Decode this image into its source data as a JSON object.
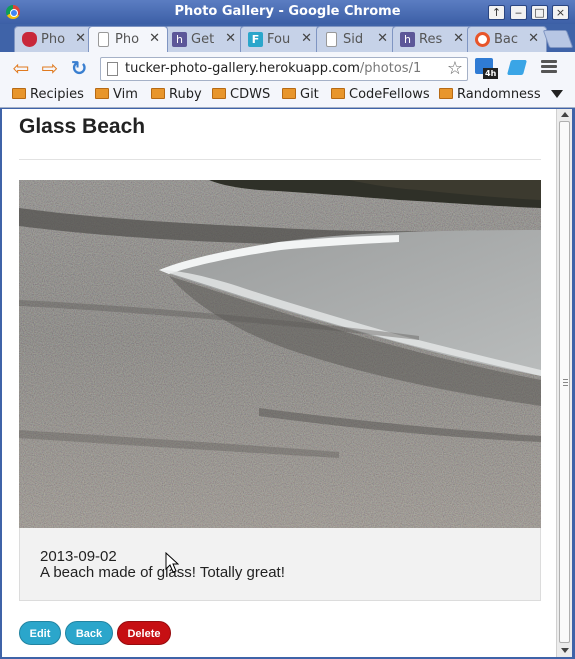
{
  "window": {
    "title": "Photo Gallery - Google Chrome",
    "controls": [
      "↑",
      "‒",
      "□",
      "×"
    ]
  },
  "tabs": [
    {
      "label": "Pho",
      "icon": "red-shield-icon",
      "active": false
    },
    {
      "label": "Pho",
      "icon": "page-icon",
      "active": true
    },
    {
      "label": "Get",
      "icon": "heroku-icon",
      "active": false
    },
    {
      "label": "Fou",
      "icon": "foundation-icon",
      "active": false
    },
    {
      "label": "Sid",
      "icon": "page-icon",
      "active": false
    },
    {
      "label": "Res",
      "icon": "heroku-icon",
      "active": false
    },
    {
      "label": "Bac",
      "icon": "lifebuoy-icon",
      "active": false
    }
  ],
  "toolbar": {
    "url_host": "tucker-photo-gallery.herokuapp.com",
    "url_path": "/photos/1",
    "ext_badge": "4h"
  },
  "bookmarks": [
    "Recipies",
    "Vim",
    "Ruby",
    "CDWS",
    "Git",
    "CodeFellows",
    "Randomness"
  ],
  "photo_page": {
    "title": "Glass Beach",
    "date": "2013-09-02",
    "description": "A beach made of glass! Totally great!",
    "buttons": {
      "edit": "Edit",
      "back": "Back",
      "delete": "Delete"
    }
  },
  "colors": {
    "button_primary": "#2ba6cb",
    "button_alert": "#c60f13",
    "titlebar": "#3f63a8"
  }
}
